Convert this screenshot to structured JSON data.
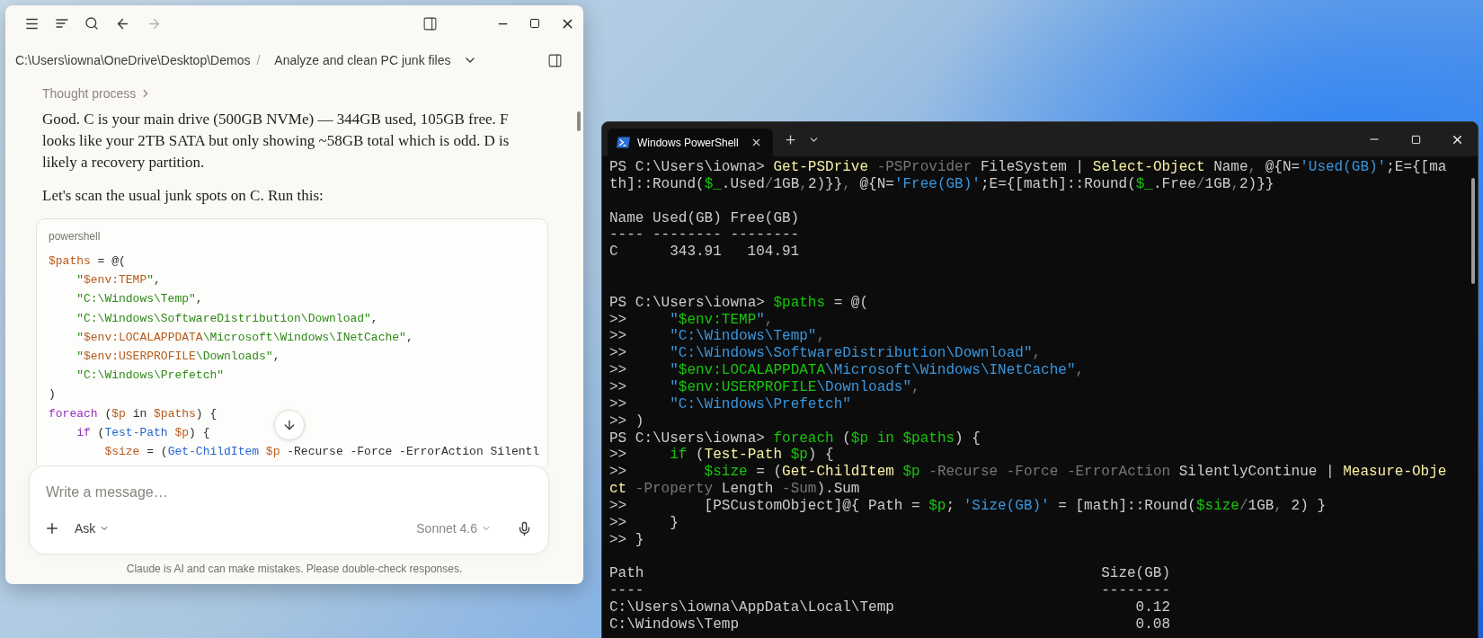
{
  "chat_window": {
    "history_buttons": [
      {
        "kind": "back",
        "disabled": false
      },
      {
        "kind": "forward",
        "disabled": true
      }
    ],
    "breadcrumb": {
      "path": "C:\\Users\\iowna\\OneDrive\\Desktop\\Demos",
      "separator": "/",
      "title": "Analyze and clean PC junk files"
    },
    "thought_process": "Thought process",
    "paragraphs": [
      "Good. C is your main drive (500GB NVMe) — 344GB used, 105GB free. F looks like your 2TB SATA but only showing ~58GB total which is odd. D is likely a recovery partition.",
      "Let's scan the usual junk spots on C. Run this:"
    ],
    "code_block": {
      "language": "powershell",
      "lines": [
        [
          {
            "kind": "var",
            "text": "$paths"
          },
          {
            "kind": "plain",
            "text": " = @("
          }
        ],
        [
          {
            "kind": "str",
            "text": "    \""
          },
          {
            "kind": "var",
            "text": "$env:TEMP"
          },
          {
            "kind": "str",
            "text": "\""
          },
          {
            "kind": "plain",
            "text": ","
          }
        ],
        [
          {
            "kind": "str",
            "text": "    \"C:\\Windows\\Temp\""
          },
          {
            "kind": "plain",
            "text": ","
          }
        ],
        [
          {
            "kind": "str",
            "text": "    \"C:\\Windows\\SoftwareDistribution\\Download\""
          },
          {
            "kind": "plain",
            "text": ","
          }
        ],
        [
          {
            "kind": "str",
            "text": "    \""
          },
          {
            "kind": "var",
            "text": "$env:LOCALAPPDATA"
          },
          {
            "kind": "str",
            "text": "\\Microsoft\\Windows\\INetCache\""
          },
          {
            "kind": "plain",
            "text": ","
          }
        ],
        [
          {
            "kind": "str",
            "text": "    \""
          },
          {
            "kind": "var",
            "text": "$env:USERPROFILE"
          },
          {
            "kind": "str",
            "text": "\\Downloads\""
          },
          {
            "kind": "plain",
            "text": ","
          }
        ],
        [
          {
            "kind": "str",
            "text": "    \"C:\\Windows\\Prefetch\""
          }
        ],
        [
          {
            "kind": "plain",
            "text": ")"
          }
        ],
        [
          {
            "kind": "kw",
            "text": "foreach"
          },
          {
            "kind": "plain",
            "text": " ("
          },
          {
            "kind": "var",
            "text": "$p"
          },
          {
            "kind": "plain",
            "text": " in "
          },
          {
            "kind": "var",
            "text": "$paths"
          },
          {
            "kind": "plain",
            "text": ") {"
          }
        ],
        [
          {
            "kind": "kw",
            "text": "    if"
          },
          {
            "kind": "plain",
            "text": " ("
          },
          {
            "kind": "cmd",
            "text": "Test-Path"
          },
          {
            "kind": "var",
            "text": " $p"
          },
          {
            "kind": "plain",
            "text": ") {"
          }
        ],
        [
          {
            "kind": "var",
            "text": "        $size"
          },
          {
            "kind": "plain",
            "text": " = ("
          },
          {
            "kind": "cmd",
            "text": "Get-ChildItem"
          },
          {
            "kind": "var",
            "text": " $p"
          },
          {
            "kind": "plain",
            "text": " -Recurse -Force -ErrorAction Silentl"
          }
        ]
      ]
    },
    "composer": {
      "placeholder": "Write a message…",
      "mode": "Ask",
      "model": "Sonnet 4.6"
    },
    "disclaimer": "Claude is AI and can make mistakes. Please double-check responses."
  },
  "terminal": {
    "tab": "Windows PowerShell",
    "blocks": [
      {
        "kind": "line",
        "tokens": [
          {
            "kind": "plain",
            "text": "PS C:\\Users\\iowna> "
          },
          {
            "kind": "cmd",
            "text": "Get-PSDrive"
          },
          {
            "kind": "param",
            "text": " -PSProvider"
          },
          {
            "kind": "plain",
            "text": " FileSystem | "
          },
          {
            "kind": "cmd",
            "text": "Select-Object"
          },
          {
            "kind": "plain",
            "text": " Name"
          },
          {
            "kind": "op",
            "text": ","
          },
          {
            "kind": "plain",
            "text": " @{N="
          },
          {
            "kind": "str",
            "text": "'Used(GB)'"
          },
          {
            "kind": "plain",
            "text": ";E={[ma"
          }
        ]
      },
      {
        "kind": "line",
        "tokens": [
          {
            "kind": "plain",
            "text": "th]::Round("
          },
          {
            "kind": "var",
            "text": "$_"
          },
          {
            "kind": "plain",
            "text": ".Used"
          },
          {
            "kind": "op",
            "text": "/"
          },
          {
            "kind": "plain",
            "text": "1GB"
          },
          {
            "kind": "op",
            "text": ","
          },
          {
            "kind": "plain",
            "text": "2)}}"
          },
          {
            "kind": "op",
            "text": ","
          },
          {
            "kind": "plain",
            "text": " @{N="
          },
          {
            "kind": "str",
            "text": "'Free(GB)'"
          },
          {
            "kind": "plain",
            "text": ";E={[math]::Round("
          },
          {
            "kind": "var",
            "text": "$_"
          },
          {
            "kind": "plain",
            "text": ".Free"
          },
          {
            "kind": "op",
            "text": "/"
          },
          {
            "kind": "plain",
            "text": "1GB"
          },
          {
            "kind": "op",
            "text": ","
          },
          {
            "kind": "plain",
            "text": "2)}}"
          }
        ]
      },
      {
        "kind": "blank"
      },
      {
        "kind": "table",
        "columns": [
          "Name",
          "Used(GB)",
          "Free(GB)"
        ],
        "dashes": [
          "----",
          "--------",
          "--------"
        ],
        "rows": [
          [
            "C",
            "343.91",
            "104.91"
          ]
        ]
      },
      {
        "kind": "blank"
      },
      {
        "kind": "blank"
      },
      {
        "kind": "line",
        "tokens": [
          {
            "kind": "plain",
            "text": "PS C:\\Users\\iowna> "
          },
          {
            "kind": "var",
            "text": "$paths"
          },
          {
            "kind": "plain",
            "text": " = @("
          }
        ]
      },
      {
        "kind": "line",
        "tokens": [
          {
            "kind": "plain",
            "text": ">>"
          },
          {
            "kind": "str",
            "text": "     \""
          },
          {
            "kind": "var",
            "text": "$env:TEMP"
          },
          {
            "kind": "str",
            "text": "\""
          },
          {
            "kind": "op",
            "text": ","
          }
        ]
      },
      {
        "kind": "line",
        "tokens": [
          {
            "kind": "plain",
            "text": ">>"
          },
          {
            "kind": "str",
            "text": "     \"C:\\Windows\\Temp\""
          },
          {
            "kind": "op",
            "text": ","
          }
        ]
      },
      {
        "kind": "line",
        "tokens": [
          {
            "kind": "plain",
            "text": ">>"
          },
          {
            "kind": "str",
            "text": "     \"C:\\Windows\\SoftwareDistribution\\Download\""
          },
          {
            "kind": "op",
            "text": ","
          }
        ]
      },
      {
        "kind": "line",
        "tokens": [
          {
            "kind": "plain",
            "text": ">>"
          },
          {
            "kind": "str",
            "text": "     \""
          },
          {
            "kind": "var",
            "text": "$env:LOCALAPPDATA"
          },
          {
            "kind": "str",
            "text": "\\Microsoft\\Windows\\INetCache\""
          },
          {
            "kind": "op",
            "text": ","
          }
        ]
      },
      {
        "kind": "line",
        "tokens": [
          {
            "kind": "plain",
            "text": ">>"
          },
          {
            "kind": "str",
            "text": "     \""
          },
          {
            "kind": "var",
            "text": "$env:USERPROFILE"
          },
          {
            "kind": "str",
            "text": "\\Downloads\""
          },
          {
            "kind": "op",
            "text": ","
          }
        ]
      },
      {
        "kind": "line",
        "tokens": [
          {
            "kind": "plain",
            "text": ">>"
          },
          {
            "kind": "str",
            "text": "     \"C:\\Windows\\Prefetch\""
          }
        ]
      },
      {
        "kind": "line",
        "tokens": [
          {
            "kind": "plain",
            "text": ">> )"
          }
        ]
      },
      {
        "kind": "line",
        "tokens": [
          {
            "kind": "plain",
            "text": "PS C:\\Users\\iowna> "
          },
          {
            "kind": "kw",
            "text": "foreach"
          },
          {
            "kind": "plain",
            "text": " ("
          },
          {
            "kind": "var",
            "text": "$p"
          },
          {
            "kind": "kw",
            "text": " in"
          },
          {
            "kind": "var",
            "text": " $paths"
          },
          {
            "kind": "plain",
            "text": ") {"
          }
        ]
      },
      {
        "kind": "line",
        "tokens": [
          {
            "kind": "plain",
            "text": ">>"
          },
          {
            "kind": "kw",
            "text": "     if"
          },
          {
            "kind": "plain",
            "text": " ("
          },
          {
            "kind": "cmd",
            "text": "Test-Path"
          },
          {
            "kind": "var",
            "text": " $p"
          },
          {
            "kind": "plain",
            "text": ") {"
          }
        ]
      },
      {
        "kind": "line",
        "tokens": [
          {
            "kind": "plain",
            "text": ">>"
          },
          {
            "kind": "var",
            "text": "         $size"
          },
          {
            "kind": "plain",
            "text": " = ("
          },
          {
            "kind": "cmd",
            "text": "Get-ChildItem"
          },
          {
            "kind": "var",
            "text": " $p"
          },
          {
            "kind": "param",
            "text": " -Recurse"
          },
          {
            "kind": "param",
            "text": " -Force"
          },
          {
            "kind": "param",
            "text": " -ErrorAction"
          },
          {
            "kind": "plain",
            "text": " SilentlyContinue | "
          },
          {
            "kind": "cmd",
            "text": "Measure-Obje"
          }
        ]
      },
      {
        "kind": "line",
        "tokens": [
          {
            "kind": "cmd",
            "text": "ct"
          },
          {
            "kind": "param",
            "text": " -Property"
          },
          {
            "kind": "plain",
            "text": " Length "
          },
          {
            "kind": "param",
            "text": "-Sum"
          },
          {
            "kind": "plain",
            "text": ").Sum"
          }
        ]
      },
      {
        "kind": "line",
        "tokens": [
          {
            "kind": "plain",
            "text": ">>         [PSCustomObject]@{ Path = "
          },
          {
            "kind": "var",
            "text": "$p"
          },
          {
            "kind": "plain",
            "text": "; "
          },
          {
            "kind": "str",
            "text": "'Size(GB)'"
          },
          {
            "kind": "plain",
            "text": " = [math]::Round("
          },
          {
            "kind": "var",
            "text": "$size"
          },
          {
            "kind": "op",
            "text": "/"
          },
          {
            "kind": "plain",
            "text": "1GB"
          },
          {
            "kind": "op",
            "text": ","
          },
          {
            "kind": "plain",
            "text": " 2) }"
          }
        ]
      },
      {
        "kind": "line",
        "tokens": [
          {
            "kind": "plain",
            "text": ">>     }"
          }
        ]
      },
      {
        "kind": "line",
        "tokens": [
          {
            "kind": "plain",
            "text": ">> }"
          }
        ]
      },
      {
        "kind": "blank"
      },
      {
        "kind": "table",
        "columns": [
          "Path",
          "Size(GB)"
        ],
        "dashes": [
          "----",
          "--------"
        ],
        "rows": [
          [
            "C:\\Users\\iowna\\AppData\\Local\\Temp",
            "0.12"
          ],
          [
            "C:\\Windows\\Temp",
            "0.08"
          ]
        ]
      }
    ]
  }
}
